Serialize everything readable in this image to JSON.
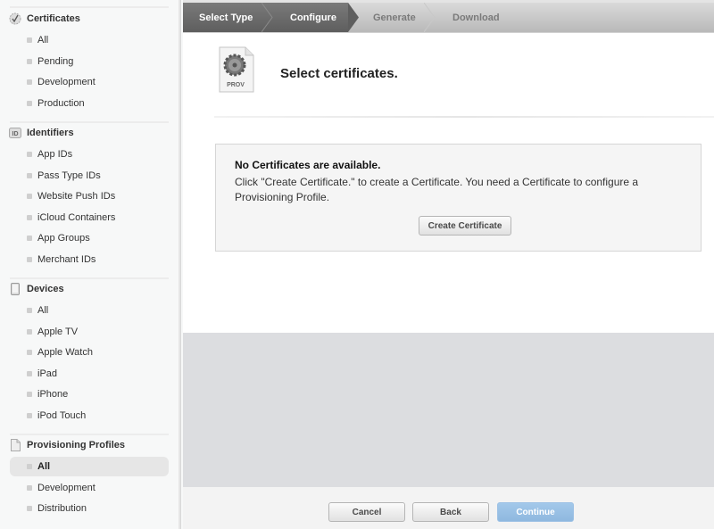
{
  "sidebar": {
    "sections": [
      {
        "title": "Certificates",
        "icon": "certificate-seal-icon",
        "items": [
          {
            "label": "All"
          },
          {
            "label": "Pending"
          },
          {
            "label": "Development"
          },
          {
            "label": "Production"
          }
        ]
      },
      {
        "title": "Identifiers",
        "icon": "id-badge-icon",
        "icon_text": "ID",
        "items": [
          {
            "label": "App IDs"
          },
          {
            "label": "Pass Type IDs"
          },
          {
            "label": "Website Push IDs"
          },
          {
            "label": "iCloud Containers"
          },
          {
            "label": "App Groups"
          },
          {
            "label": "Merchant IDs"
          }
        ]
      },
      {
        "title": "Devices",
        "icon": "device-icon",
        "items": [
          {
            "label": "All"
          },
          {
            "label": "Apple TV"
          },
          {
            "label": "Apple Watch"
          },
          {
            "label": "iPad"
          },
          {
            "label": "iPhone"
          },
          {
            "label": "iPod Touch"
          }
        ]
      },
      {
        "title": "Provisioning Profiles",
        "icon": "document-icon",
        "items": [
          {
            "label": "All",
            "active": true
          },
          {
            "label": "Development"
          },
          {
            "label": "Distribution"
          }
        ]
      }
    ]
  },
  "steps": [
    {
      "label": "Select Type",
      "state": "done"
    },
    {
      "label": "Configure",
      "state": "current"
    },
    {
      "label": "Generate",
      "state": "todo"
    },
    {
      "label": "Download",
      "state": "todo"
    }
  ],
  "main": {
    "icon_label": "PROV",
    "title": "Select certificates.",
    "notice": {
      "title": "No Certificates are available.",
      "text": "Click \"Create Certificate.\" to create a Certificate. You need a Certificate to configure a Provisioning Profile.",
      "button": "Create Certificate"
    }
  },
  "footer": {
    "cancel": "Cancel",
    "back": "Back",
    "continue": "Continue"
  },
  "colors": {
    "accent_disabled": "#9fc4e8",
    "step_active": "#6a6a6a"
  }
}
